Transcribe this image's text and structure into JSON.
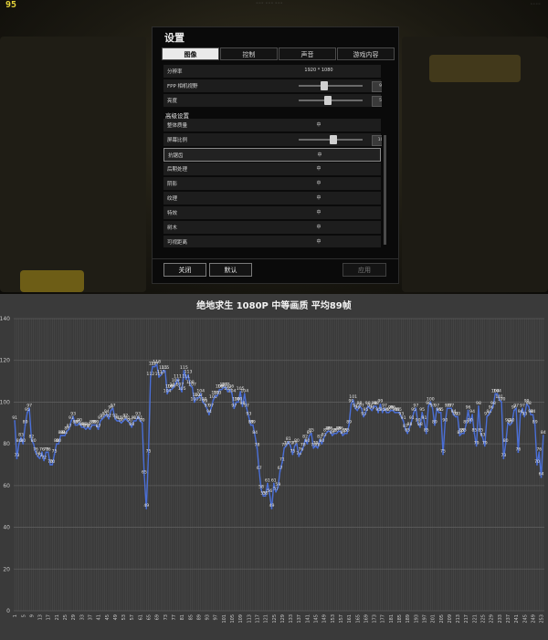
{
  "overlay": {
    "fps": "95"
  },
  "dialog": {
    "title": "设置",
    "tabs": [
      {
        "label": "图像",
        "active": true
      },
      {
        "label": "控制",
        "active": false
      },
      {
        "label": "声音",
        "active": false
      },
      {
        "label": "游戏内容",
        "active": false
      }
    ],
    "settings": [
      {
        "label": "分辨率",
        "value": "1920 * 1080"
      },
      {
        "label": "FPP 相机视野",
        "slider": 0.38,
        "box": "90"
      },
      {
        "label": "亮度",
        "slider": 0.45,
        "box": "50"
      },
      {
        "section": "高级设置"
      },
      {
        "label": "整体质量",
        "value": "中"
      },
      {
        "label": "屏幕比例",
        "slider": 0.55,
        "box": "100"
      },
      {
        "label": "抗锯齿",
        "value": "中",
        "selected": true
      },
      {
        "label": "后期处理",
        "value": "中"
      },
      {
        "label": "阴影",
        "value": "中"
      },
      {
        "label": "纹理",
        "value": "中"
      },
      {
        "label": "特效",
        "value": "中"
      },
      {
        "label": "树木",
        "value": "中"
      },
      {
        "label": "可视距离",
        "value": "中"
      }
    ],
    "buttons": {
      "close": "关闭",
      "default": "默认",
      "apply": "应用"
    }
  },
  "chart_data": {
    "type": "line",
    "title": "绝地求生 1080P 中等画质 平均89帧",
    "xlabel": "",
    "ylabel": "",
    "ylim": [
      0,
      140
    ],
    "yticks": [
      0,
      20,
      40,
      60,
      80,
      100,
      120,
      140
    ],
    "grid": true,
    "series_color": "#4a6fd8",
    "x_start": 1,
    "values": [
      91,
      73,
      80,
      83,
      80,
      89,
      95,
      97,
      82,
      80,
      76,
      74,
      73,
      76,
      72,
      76,
      76,
      70,
      70,
      75,
      80,
      80,
      84,
      84,
      84,
      86,
      87,
      91,
      93,
      89,
      89,
      90,
      88,
      88,
      87,
      88,
      87,
      89,
      89,
      89,
      87,
      91,
      92,
      93,
      94,
      92,
      96,
      97,
      92,
      91,
      91,
      90,
      91,
      92,
      91,
      90,
      88,
      91,
      91,
      93,
      91,
      90,
      65,
      49,
      75,
      112,
      117,
      117,
      118,
      112,
      113,
      115,
      115,
      104,
      106,
      106,
      107,
      109,
      111,
      107,
      105,
      115,
      111,
      113,
      108,
      107,
      100,
      102,
      102,
      104,
      100,
      99,
      97,
      94,
      97,
      101,
      103,
      103,
      106,
      106,
      107,
      107,
      105,
      106,
      104,
      97,
      100,
      100,
      105,
      98,
      104,
      97,
      93,
      89,
      89,
      84,
      78,
      67,
      58,
      55,
      55,
      61,
      56,
      49,
      61,
      57,
      59,
      67,
      71,
      78,
      79,
      81,
      79,
      75,
      79,
      80,
      74,
      76,
      78,
      82,
      80,
      84,
      85,
      78,
      79,
      78,
      82,
      80,
      83,
      85,
      86,
      86,
      84,
      85,
      85,
      86,
      86,
      84,
      85,
      85,
      89,
      99,
      101,
      97,
      96,
      98,
      97,
      93,
      95,
      98,
      97,
      96,
      98,
      98,
      95,
      99,
      95,
      97,
      95,
      95,
      96,
      96,
      95,
      95,
      95,
      93,
      91,
      87,
      85,
      88,
      91,
      95,
      97,
      90,
      88,
      95,
      91,
      85,
      98,
      100,
      97,
      89,
      97,
      95,
      95,
      75,
      90,
      97,
      97,
      97,
      94,
      93,
      93,
      84,
      85,
      85,
      89,
      96,
      90,
      94,
      85,
      79,
      98,
      85,
      83,
      79,
      93,
      94,
      96,
      98,
      104,
      104,
      101,
      100,
      73,
      80,
      90,
      89,
      90,
      96,
      97,
      76,
      94,
      97,
      93,
      99,
      98,
      94,
      94,
      89,
      70,
      76,
      64,
      84
    ],
    "x_tick_labels_shown": "every 4th index: 1, 5, 9, ... 285"
  }
}
